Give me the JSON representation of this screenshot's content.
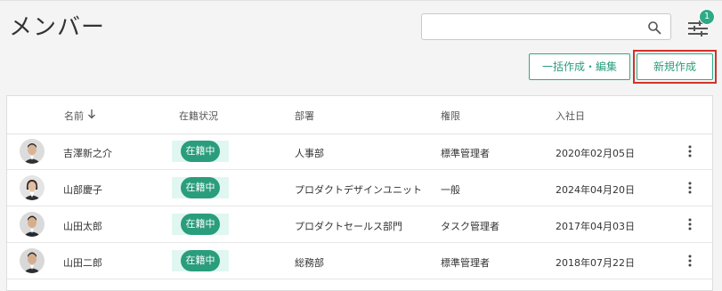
{
  "page": {
    "title": "メンバー"
  },
  "search": {
    "placeholder": "",
    "value": ""
  },
  "filter": {
    "badge_count": "1"
  },
  "actions": {
    "bulk_label": "一括作成・編集",
    "new_label": "新規作成"
  },
  "table": {
    "columns": [
      "名前",
      "在籍状況",
      "部署",
      "権限",
      "入社日"
    ],
    "rows": [
      {
        "name": "吉澤新之介",
        "status": "在籍中",
        "department": "人事部",
        "role": "標準管理者",
        "joined": "2020年02月05日"
      },
      {
        "name": "山部慶子",
        "status": "在籍中",
        "department": "プロダクトデザインユニット",
        "role": "一般",
        "joined": "2024年04月20日"
      },
      {
        "name": "山田太郎",
        "status": "在籍中",
        "department": "プロダクトセールス部門",
        "role": "タスク管理者",
        "joined": "2017年04月03日"
      },
      {
        "name": "山田二郎",
        "status": "在籍中",
        "department": "総務部",
        "role": "標準管理者",
        "joined": "2018年07月22日"
      }
    ]
  },
  "colors": {
    "accent": "#2eaa86",
    "highlight": "#d2322b"
  }
}
